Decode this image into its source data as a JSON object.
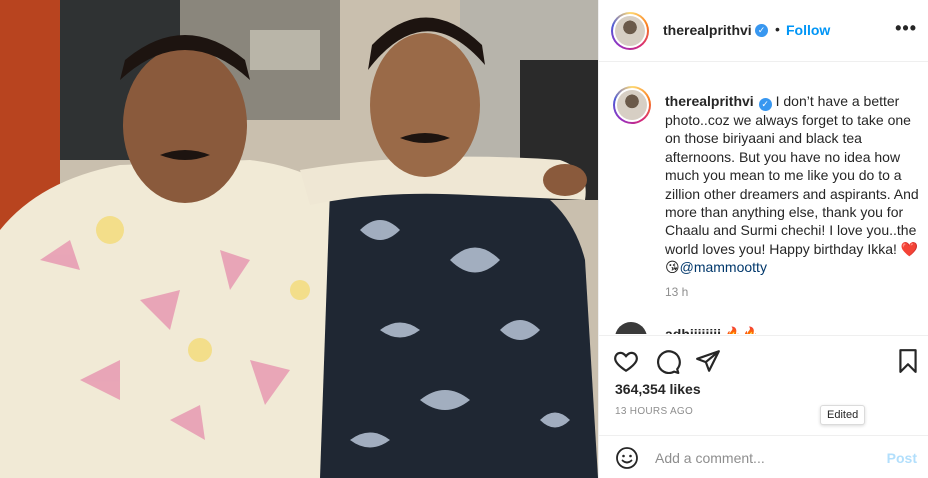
{
  "header": {
    "username": "therealprithvi",
    "verified_glyph": "✓",
    "separator": "•",
    "follow_label": "Follow",
    "more_label": "•••"
  },
  "caption": {
    "username": "therealprithvi",
    "text": "I don’t have a better photo..coz we always forget to take one on those biriyaani and black tea afternoons. But you have no idea how much you mean to me like you do to a zillion other dreamers and aspirants. And more than anything else, thank you for Chaalu and Surmi chechi! I love you..the world loves you! Happy birthday Ikka! ❤️😘",
    "mention": "@mammootty",
    "time": "13 h"
  },
  "comment_peek": {
    "text": "adhiiiiiiii 🔥🔥"
  },
  "actions": {
    "like_icon": "heart-icon",
    "comment_icon": "comment-icon",
    "share_icon": "paper-plane-icon",
    "save_icon": "bookmark-icon"
  },
  "likes": "364,354 likes",
  "posted_ago": "13 HOURS AGO",
  "tooltip": "Edited",
  "add_comment": {
    "placeholder": "Add a comment...",
    "post_label": "Post",
    "emoji_icon": "smiley-icon"
  },
  "colors": {
    "accent": "#0095f6",
    "post_disabled": "#b2dffc",
    "muted": "#8e8e8e",
    "text": "#262626",
    "mention": "#00376b"
  }
}
